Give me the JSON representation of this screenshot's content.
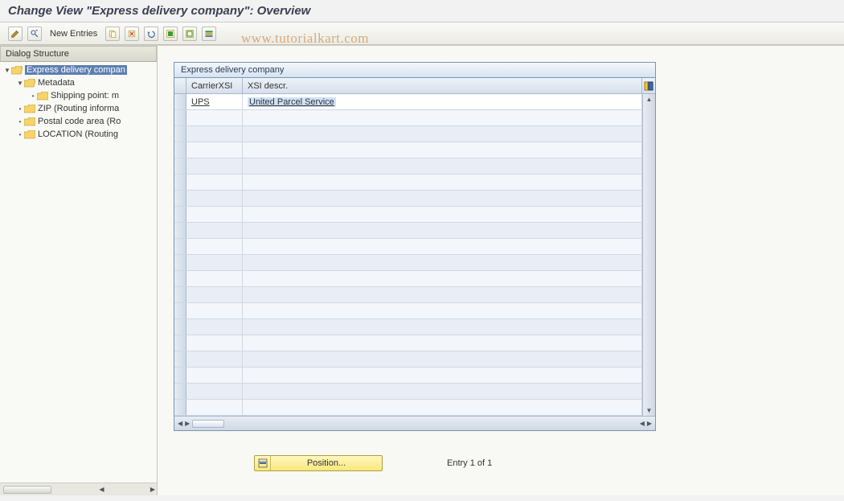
{
  "header": {
    "title": "Change View \"Express delivery company\": Overview"
  },
  "watermark": "www.tutorialkart.com",
  "toolbar": {
    "new_entries": "New Entries"
  },
  "tree": {
    "header": "Dialog Structure",
    "items": [
      {
        "label": "Express delivery compan",
        "selected": true,
        "open": true,
        "indent": 0,
        "toggle": "▼"
      },
      {
        "label": "Metadata",
        "selected": false,
        "open": true,
        "indent": 1,
        "toggle": "▼"
      },
      {
        "label": "Shipping point: m",
        "selected": false,
        "open": false,
        "indent": 2,
        "toggle": "•"
      },
      {
        "label": "ZIP (Routing informa",
        "selected": false,
        "open": false,
        "indent": 1,
        "toggle": "•"
      },
      {
        "label": "Postal code area (Ro",
        "selected": false,
        "open": false,
        "indent": 1,
        "toggle": "•"
      },
      {
        "label": "LOCATION (Routing",
        "selected": false,
        "open": false,
        "indent": 1,
        "toggle": "•"
      }
    ]
  },
  "grid": {
    "title": "Express delivery company",
    "columns": [
      "CarrierXSI",
      "XSI descr."
    ],
    "rows": [
      {
        "carrier": "UPS",
        "descr": "United Parcel Service"
      }
    ],
    "empty_rows": 19
  },
  "footer": {
    "position_label": "Position...",
    "entry_text": "Entry 1 of 1"
  }
}
